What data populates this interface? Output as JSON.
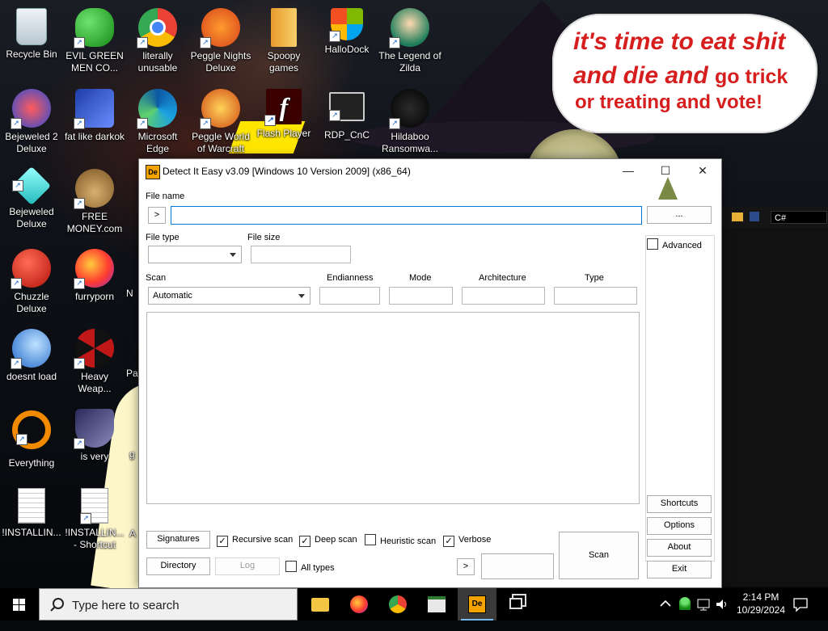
{
  "wallpaper": {
    "speech_line1": "it's time to eat shit",
    "speech_line2a": "and die and",
    "speech_line2b": "go trick",
    "speech_line3": "or treating and vote!"
  },
  "desktop_icons": [
    {
      "label": "Recycle Bin",
      "icon": "recycle-bin-icon"
    },
    {
      "label": "EVIL GREEN MEN CO...",
      "icon": "green-men-icon"
    },
    {
      "label": "literally unusable",
      "icon": "chrome-icon"
    },
    {
      "label": "Peggle Nights Deluxe",
      "icon": "peggle-icon"
    },
    {
      "label": "Spoopy games",
      "icon": "folder-icon"
    },
    {
      "label": "HalloDock",
      "icon": "windows-logo-icon"
    },
    {
      "label": "The Legend of Zilda",
      "icon": "zilda-icon"
    },
    {
      "label": "Bejeweled 2 Deluxe",
      "icon": "bejeweled2-icon"
    },
    {
      "label": "fat like darkok",
      "icon": "mpl-icon"
    },
    {
      "label": "Microsoft Edge",
      "icon": "edge-icon"
    },
    {
      "label": "Peggle World of Warcraft",
      "icon": "peggle-wow-icon"
    },
    {
      "label": "Flash Player",
      "icon": "flash-icon"
    },
    {
      "label": "RDP_CnC",
      "icon": "rdp-icon"
    },
    {
      "label": "Hildaboo Ransomwa...",
      "icon": "hildaboo-icon"
    },
    {
      "label": "Bejeweled Deluxe",
      "icon": "diamond-icon"
    },
    {
      "label": "FREE MONEY.com",
      "icon": "money-bag-icon"
    },
    {
      "label": "Chuzzle Deluxe",
      "icon": "chuzzle-icon"
    },
    {
      "label": "furryporn",
      "icon": "firefox-icon"
    },
    {
      "label": "doesnt load",
      "icon": "thunderbird-icon"
    },
    {
      "label": "Heavy Weap...",
      "icon": "radiation-icon"
    },
    {
      "label": "Everything",
      "icon": "everything-icon"
    },
    {
      "label": "is very",
      "icon": "mpl-shield-icon"
    },
    {
      "label": "!INSTALLIN...",
      "icon": "document-icon"
    },
    {
      "label": "!INSTALLIN... - Shortcut",
      "icon": "document-shortcut-icon"
    }
  ],
  "partial_labels": {
    "n": "N",
    "pa": "Pa",
    "g": "g",
    "a": "A"
  },
  "die": {
    "title": "Detect It Easy v3.09 [Windows 10 Version 2009] (x86_64)",
    "app_icon_text": "De",
    "minimize": "—",
    "maximize": "☐",
    "close": "✕",
    "file_name_label": "File name",
    "file_name_value": "",
    "history_button": ">",
    "browse_button": "...",
    "file_type_label": "File type",
    "file_type_value": "",
    "file_size_label": "File size",
    "file_size_value": "",
    "scan_label": "Scan",
    "scan_value": "Automatic",
    "endianness_label": "Endianness",
    "mode_label": "Mode",
    "architecture_label": "Architecture",
    "type_label": "Type",
    "advanced_label": "Advanced",
    "signatures_button": "Signatures",
    "recursive_scan": "Recursive scan",
    "deep_scan": "Deep scan",
    "heuristic_scan": "Heuristic scan",
    "verbose": "Verbose",
    "directory_button": "Directory",
    "log_button": "Log",
    "all_types": "All types",
    "more_button": ">",
    "scan_button": "Scan",
    "shortcuts_button": "Shortcuts",
    "options_button": "Options",
    "about_button": "About",
    "exit_button": "Exit",
    "checks": {
      "advanced": false,
      "recursive": true,
      "deep": true,
      "heuristic": false,
      "verbose": true,
      "all_types": false
    }
  },
  "otherwin": {
    "field_value": "C#"
  },
  "taskbar": {
    "search_placeholder": "Type here to search",
    "time": "2:14 PM",
    "date": "10/29/2024"
  },
  "colors": {
    "speech_red": "#d71e1e",
    "focus_blue": "#0078d7",
    "taskbar": "#000000"
  }
}
